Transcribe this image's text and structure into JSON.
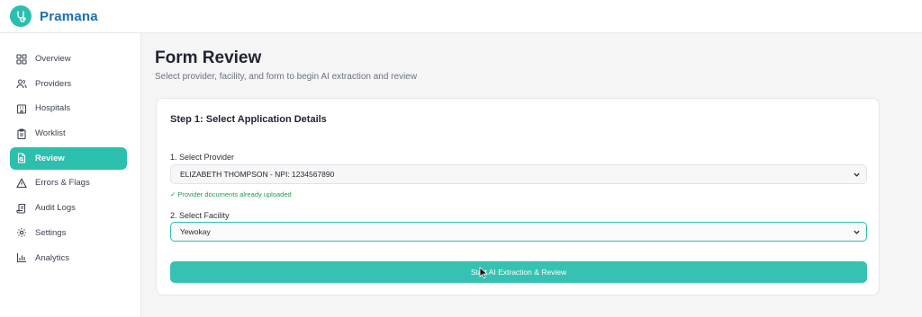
{
  "app": {
    "brand": "Pramana",
    "brand_color": "#1a6fb0",
    "accent_color": "#2bbfae"
  },
  "sidebar": {
    "items": [
      {
        "label": "Overview",
        "icon": "grid-icon",
        "active": false
      },
      {
        "label": "Providers",
        "icon": "users-icon",
        "active": false
      },
      {
        "label": "Hospitals",
        "icon": "building-icon",
        "active": false
      },
      {
        "label": "Worklist",
        "icon": "clipboard-icon",
        "active": false
      },
      {
        "label": "Review",
        "icon": "document-search-icon",
        "active": true
      },
      {
        "label": "Errors & Flags",
        "icon": "warning-icon",
        "active": false
      },
      {
        "label": "Audit Logs",
        "icon": "scroll-icon",
        "active": false
      },
      {
        "label": "Settings",
        "icon": "gear-icon",
        "active": false
      },
      {
        "label": "Analytics",
        "icon": "bar-chart-icon",
        "active": false
      }
    ]
  },
  "main": {
    "title": "Form Review",
    "subtitle": "Select provider, facility, and form to begin AI extraction and review",
    "card": {
      "title": "Step 1: Select Application Details",
      "provider_label": "1. Select Provider",
      "provider_value": "ELIZABETH THOMPSON - NPI: 1234567890",
      "provider_hint": "✓ Provider documents already uploaded",
      "facility_label": "2. Select Facility",
      "facility_value": "Yewokay",
      "start_button": "Start AI Extraction & Review"
    }
  }
}
